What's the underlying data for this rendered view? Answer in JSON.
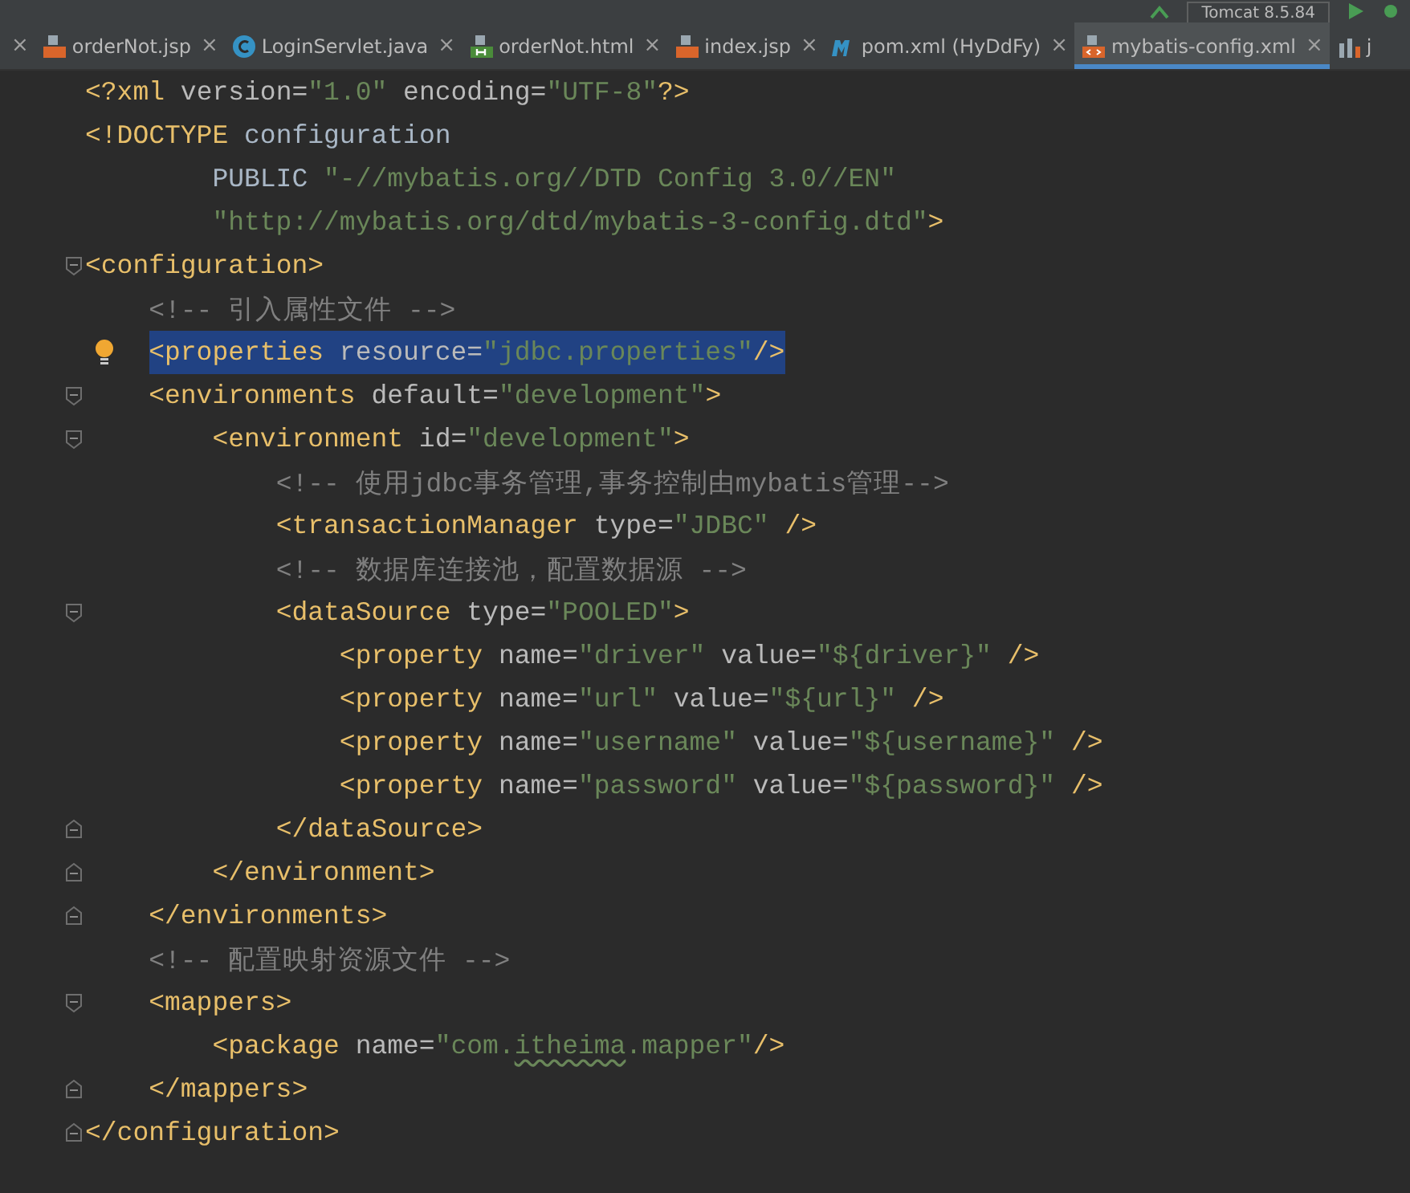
{
  "toolbar": {
    "run_config": "Tomcat 8.5.84"
  },
  "tabs": [
    {
      "kind": "stub",
      "close": "×",
      "selected": false
    },
    {
      "kind": "jsp",
      "label": "orderNot.jsp",
      "close": "×",
      "selected": false
    },
    {
      "kind": "class",
      "label": "LoginServlet.java",
      "close": "×",
      "selected": false
    },
    {
      "kind": "html",
      "label": "orderNot.html",
      "close": "×",
      "selected": false
    },
    {
      "kind": "jsp",
      "label": "index.jsp",
      "close": "×",
      "selected": false
    },
    {
      "kind": "maven",
      "label": "pom.xml (HyDdFy)",
      "close": "×",
      "selected": false
    },
    {
      "kind": "xml",
      "label": "mybatis-config.xml",
      "close": "×",
      "selected": true
    },
    {
      "kind": "chart",
      "label": "j",
      "selected": false
    }
  ],
  "lines": [
    {
      "tokens": [
        {
          "kind": "tag",
          "text": "<?xml"
        },
        {
          "kind": "attr",
          "text": " version="
        },
        {
          "kind": "value",
          "text": "\"1.0\""
        },
        {
          "kind": "attr",
          "text": " encoding="
        },
        {
          "kind": "value",
          "text": "\"UTF-8\""
        },
        {
          "kind": "tag",
          "text": "?>"
        }
      ]
    },
    {
      "continuation": true,
      "tokens": [
        {
          "kind": "tag",
          "text": "<!DOCTYPE"
        },
        {
          "kind": "text",
          "text": " configuration"
        }
      ],
      "children": [
        {
          "tokens": [
            {
              "kind": "text",
              "text": "PUBLIC "
            },
            {
              "kind": "value",
              "text": "\"-//mybatis.org//DTD Config 3.0//EN\""
            }
          ]
        },
        {
          "tokens": [
            {
              "kind": "value",
              "text": "\"http://mybatis.org/dtd/mybatis-3-config.dtd\""
            },
            {
              "kind": "tag",
              "text": ">"
            }
          ]
        }
      ]
    },
    {
      "fold_start": true,
      "tokens": [
        {
          "kind": "tag",
          "text": "<configuration>"
        }
      ],
      "children": [
        {
          "tokens": [
            {
              "kind": "comment",
              "text": "<!-- 引入属性文件 -->"
            }
          ]
        },
        {
          "bulb": true,
          "selected": true,
          "tokens": [
            {
              "kind": "tag",
              "text": "<properties"
            },
            {
              "kind": "attr",
              "text": " resource="
            },
            {
              "kind": "value",
              "text": "\"jdbc.properties\""
            },
            {
              "kind": "tag",
              "text": "/>"
            }
          ]
        },
        {
          "fold_start": true,
          "tokens": [
            {
              "kind": "tag",
              "text": "<environments"
            },
            {
              "kind": "attr",
              "text": " default="
            },
            {
              "kind": "value",
              "text": "\"development\""
            },
            {
              "kind": "tag",
              "text": ">"
            }
          ],
          "children": [
            {
              "fold_start": true,
              "tokens": [
                {
                  "kind": "tag",
                  "text": "<environment"
                },
                {
                  "kind": "attr",
                  "text": " id="
                },
                {
                  "kind": "value",
                  "text": "\"development\""
                },
                {
                  "kind": "tag",
                  "text": ">"
                }
              ],
              "children": [
                {
                  "tokens": [
                    {
                      "kind": "comment",
                      "text": "<!-- 使用jdbc事务管理,事务控制由mybatis管理-->"
                    }
                  ]
                },
                {
                  "tokens": [
                    {
                      "kind": "tag",
                      "text": "<transactionManager"
                    },
                    {
                      "kind": "attr",
                      "text": " type="
                    },
                    {
                      "kind": "value",
                      "text": "\"JDBC\""
                    },
                    {
                      "kind": "tag",
                      "text": " />"
                    }
                  ]
                },
                {
                  "tokens": [
                    {
                      "kind": "comment",
                      "text": "<!-- 数据库连接池，配置数据源 -->"
                    }
                  ]
                },
                {
                  "fold_start": true,
                  "tokens": [
                    {
                      "kind": "tag",
                      "text": "<dataSource"
                    },
                    {
                      "kind": "attr",
                      "text": " type="
                    },
                    {
                      "kind": "value",
                      "text": "\"POOLED\""
                    },
                    {
                      "kind": "tag",
                      "text": ">"
                    }
                  ],
                  "children": [
                    {
                      "tokens": [
                        {
                          "kind": "tag",
                          "text": "<property"
                        },
                        {
                          "kind": "attr",
                          "text": " name="
                        },
                        {
                          "kind": "value",
                          "text": "\"driver\""
                        },
                        {
                          "kind": "attr",
                          "text": " value="
                        },
                        {
                          "kind": "value",
                          "text": "\"${driver}\""
                        },
                        {
                          "kind": "tag",
                          "text": " />"
                        }
                      ]
                    },
                    {
                      "tokens": [
                        {
                          "kind": "tag",
                          "text": "<property"
                        },
                        {
                          "kind": "attr",
                          "text": " name="
                        },
                        {
                          "kind": "value",
                          "text": "\"url\""
                        },
                        {
                          "kind": "attr",
                          "text": " value="
                        },
                        {
                          "kind": "value",
                          "text": "\"${url}\""
                        },
                        {
                          "kind": "tag",
                          "text": " />"
                        }
                      ]
                    },
                    {
                      "tokens": [
                        {
                          "kind": "tag",
                          "text": "<property"
                        },
                        {
                          "kind": "attr",
                          "text": " name="
                        },
                        {
                          "kind": "value",
                          "text": "\"username\""
                        },
                        {
                          "kind": "attr",
                          "text": " value="
                        },
                        {
                          "kind": "value",
                          "text": "\"${username}\""
                        },
                        {
                          "kind": "tag",
                          "text": " />"
                        }
                      ]
                    },
                    {
                      "tokens": [
                        {
                          "kind": "tag",
                          "text": "<property"
                        },
                        {
                          "kind": "attr",
                          "text": " name="
                        },
                        {
                          "kind": "value",
                          "text": "\"password\""
                        },
                        {
                          "kind": "attr",
                          "text": " value="
                        },
                        {
                          "kind": "value",
                          "text": "\"${password}\""
                        },
                        {
                          "kind": "tag",
                          "text": " />"
                        }
                      ]
                    }
                  ]
                },
                {
                  "fold_end": true,
                  "tokens": [
                    {
                      "kind": "tag",
                      "text": "</dataSource>"
                    }
                  ]
                }
              ]
            },
            {
              "fold_end": true,
              "tokens": [
                {
                  "kind": "tag",
                  "text": "</environment>"
                }
              ]
            }
          ]
        },
        {
          "fold_end": true,
          "tokens": [
            {
              "kind": "tag",
              "text": "</environments>"
            }
          ]
        },
        {
          "tokens": [
            {
              "kind": "comment",
              "text": "<!-- 配置映射资源文件 -->"
            }
          ]
        },
        {
          "fold_start": true,
          "tokens": [
            {
              "kind": "tag",
              "text": "<mappers>"
            }
          ],
          "children": [
            {
              "tokens": [
                {
                  "kind": "tag",
                  "text": "<package"
                },
                {
                  "kind": "attr",
                  "text": " name="
                },
                {
                  "kind": "value",
                  "text": "\"com."
                },
                {
                  "kind": "typo",
                  "text": "itheima"
                },
                {
                  "kind": "value",
                  "text": ".mapper\""
                },
                {
                  "kind": "tag",
                  "text": "/>"
                }
              ]
            }
          ]
        },
        {
          "fold_end": true,
          "tokens": [
            {
              "kind": "tag",
              "text": "</mappers>"
            }
          ]
        }
      ]
    },
    {
      "fold_end": true,
      "tokens": [
        {
          "kind": "tag",
          "text": "</configuration>"
        }
      ]
    }
  ]
}
